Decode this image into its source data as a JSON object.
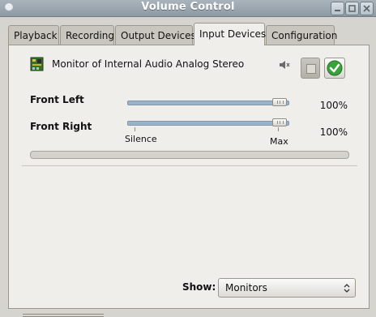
{
  "window": {
    "title": "Volume Control"
  },
  "tabs": [
    {
      "label": "Playback"
    },
    {
      "label": "Recording"
    },
    {
      "label": "Output Devices"
    },
    {
      "label": "Input Devices"
    },
    {
      "label": "Configuration"
    }
  ],
  "active_tab": "Input Devices",
  "device": {
    "name": "Monitor of Internal Audio Analog Stereo",
    "icon": "sound-card-icon",
    "mute_icon": "speaker-muted-icon",
    "lock_icon": "lock-channels-icon",
    "default_icon": "checkmark-icon"
  },
  "channels": [
    {
      "name": "Front Left",
      "percent_label": "100%",
      "level": 1.0
    },
    {
      "name": "Front Right",
      "percent_label": "100%",
      "level": 1.0
    }
  ],
  "scale": {
    "silence": "Silence",
    "max": "Max"
  },
  "footer": {
    "show_label": "Show:",
    "show_value": "Monitors"
  },
  "colors": {
    "accent_check": "#3aa23a",
    "slider_track": "#9bb3c9"
  }
}
